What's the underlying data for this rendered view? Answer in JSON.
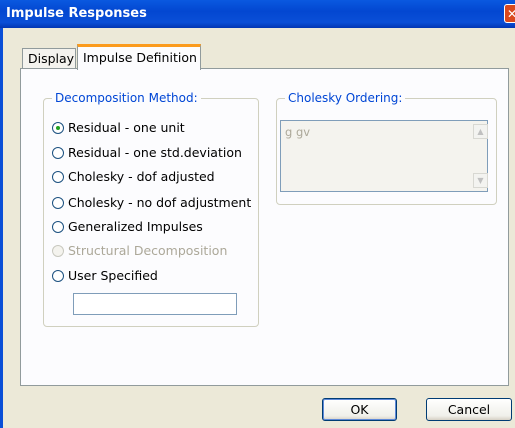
{
  "window": {
    "title": "Impulse Responses",
    "close_icon": "close-icon"
  },
  "tabs": [
    {
      "label": "Display",
      "selected": false
    },
    {
      "label": "Impulse Definition",
      "selected": true
    }
  ],
  "decomposition": {
    "label": "Decomposition Method:",
    "options": [
      {
        "label": "Residual - one unit",
        "checked": true,
        "enabled": true
      },
      {
        "label": "Residual - one std.deviation",
        "checked": false,
        "enabled": true
      },
      {
        "label": "Cholesky - dof adjusted",
        "checked": false,
        "enabled": true
      },
      {
        "label": "Cholesky - no dof adjustment",
        "checked": false,
        "enabled": true
      },
      {
        "label": "Generalized Impulses",
        "checked": false,
        "enabled": true
      },
      {
        "label": "Structural Decomposition",
        "checked": false,
        "enabled": false
      },
      {
        "label": "User Specified",
        "checked": false,
        "enabled": true
      }
    ],
    "user_specified_value": ""
  },
  "cholesky": {
    "label": "Cholesky Ordering:",
    "value": "g gv"
  },
  "buttons": {
    "ok": "OK",
    "cancel": "Cancel"
  }
}
